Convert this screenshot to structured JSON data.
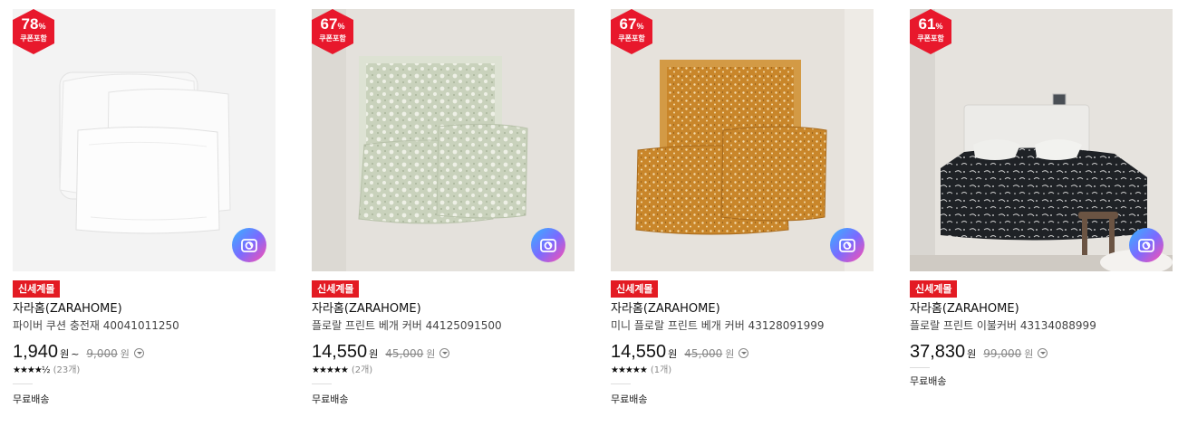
{
  "products": [
    {
      "discount": "78",
      "discount_unit": "%",
      "coupon_note": "쿠폰포함",
      "tag": "신세계몰",
      "brand": "자라홈(ZARAHOME)",
      "name": "파이버 쿠션 충전재 40041011250",
      "price": "1,940",
      "price_unit": "원",
      "price_suffix": "~",
      "original_price": "9,000",
      "original_unit": "원",
      "stars": "★★★★½",
      "review_count": "(23개)",
      "shipping": "무료배송",
      "image": "white-cushion-inserts"
    },
    {
      "discount": "67",
      "discount_unit": "%",
      "coupon_note": "쿠폰포함",
      "tag": "신세계몰",
      "brand": "자라홈(ZARAHOME)",
      "name": "플로랄 프린트 베개 커버 44125091500",
      "price": "14,550",
      "price_unit": "원",
      "price_suffix": "",
      "original_price": "45,000",
      "original_unit": "원",
      "stars": "★★★★★",
      "review_count": "(2개)",
      "shipping": "무료배송",
      "image": "green-floral-pillowcases"
    },
    {
      "discount": "67",
      "discount_unit": "%",
      "coupon_note": "쿠폰포함",
      "tag": "신세계몰",
      "brand": "자라홈(ZARAHOME)",
      "name": "미니 플로랄 프린트 베개 커버 43128091999",
      "price": "14,550",
      "price_unit": "원",
      "price_suffix": "",
      "original_price": "45,000",
      "original_unit": "원",
      "stars": "★★★★★",
      "review_count": "(1개)",
      "shipping": "무료배송",
      "image": "mustard-mini-floral-pillowcases"
    },
    {
      "discount": "61",
      "discount_unit": "%",
      "coupon_note": "쿠폰포함",
      "tag": "신세계몰",
      "brand": "자라홈(ZARAHOME)",
      "name": "플로랄 프린트 이불커버 43134088999",
      "price": "37,830",
      "price_unit": "원",
      "price_suffix": "",
      "original_price": "99,000",
      "original_unit": "원",
      "stars": "",
      "review_count": "",
      "shipping": "무료배송",
      "image": "black-floral-duvet-bedroom"
    }
  ],
  "colors": {
    "badge_red": "#e8182c",
    "tag_red": "#e31b23",
    "price_text": "#111111",
    "strike_text": "#888888"
  },
  "icons": {
    "camera": "camera-icon",
    "info": "info-dropdown-icon"
  }
}
